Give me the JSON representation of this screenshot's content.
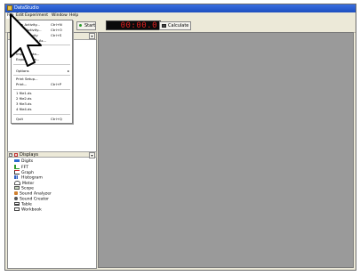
{
  "window": {
    "title": "DataStudio"
  },
  "menubar": [
    "File",
    "Edit",
    "Experiment",
    "Window",
    "Help"
  ],
  "toolbar": {
    "start_label": "Start",
    "clock_value": "00:00.0",
    "calculate_label": "Calculate"
  },
  "file_menu": {
    "items": [
      {
        "label": "New Activity...",
        "shortcut": "Ctrl+N"
      },
      {
        "label": "Open Activity...",
        "shortcut": "Ctrl+O"
      },
      {
        "label": "Save Activity",
        "shortcut": "Ctrl+S"
      },
      {
        "label": "Save Activity As..."
      },
      {
        "label": "Close"
      },
      {
        "label": "Import Data..."
      },
      {
        "label": "Export Data..."
      },
      {
        "label": "Options",
        "submenu": true
      },
      {
        "label": "Print Setup..."
      },
      {
        "label": "Print...",
        "shortcut": "Ctrl+P"
      },
      {
        "label": "1 file1.ds"
      },
      {
        "label": "2 file2.ds"
      },
      {
        "label": "3 file3.ds"
      },
      {
        "label": "4 file4.ds"
      },
      {
        "label": "Quit",
        "shortcut": "Ctrl+Q"
      }
    ]
  },
  "displays": {
    "title": "Displays",
    "items": [
      {
        "label": "Digits",
        "icon": "digits-icon"
      },
      {
        "label": "FFT",
        "icon": "fft-icon"
      },
      {
        "label": "Graph",
        "icon": "graph-icon"
      },
      {
        "label": "Histogram",
        "icon": "histogram-icon"
      },
      {
        "label": "Meter",
        "icon": "meter-icon"
      },
      {
        "label": "Scope",
        "icon": "scope-icon"
      },
      {
        "label": "Sound Analyzer",
        "icon": "sound-analyzer-icon"
      },
      {
        "label": "Sound Creator",
        "icon": "sound-creator-icon"
      },
      {
        "label": "Table",
        "icon": "table-icon"
      },
      {
        "label": "Workbook",
        "icon": "workbook-icon"
      }
    ]
  },
  "colors": {
    "titlebar": "#1d4fbf",
    "workspace": "#9a9a9a",
    "clock_bg": "#0a0a0a",
    "clock_digits": "#e02020"
  }
}
